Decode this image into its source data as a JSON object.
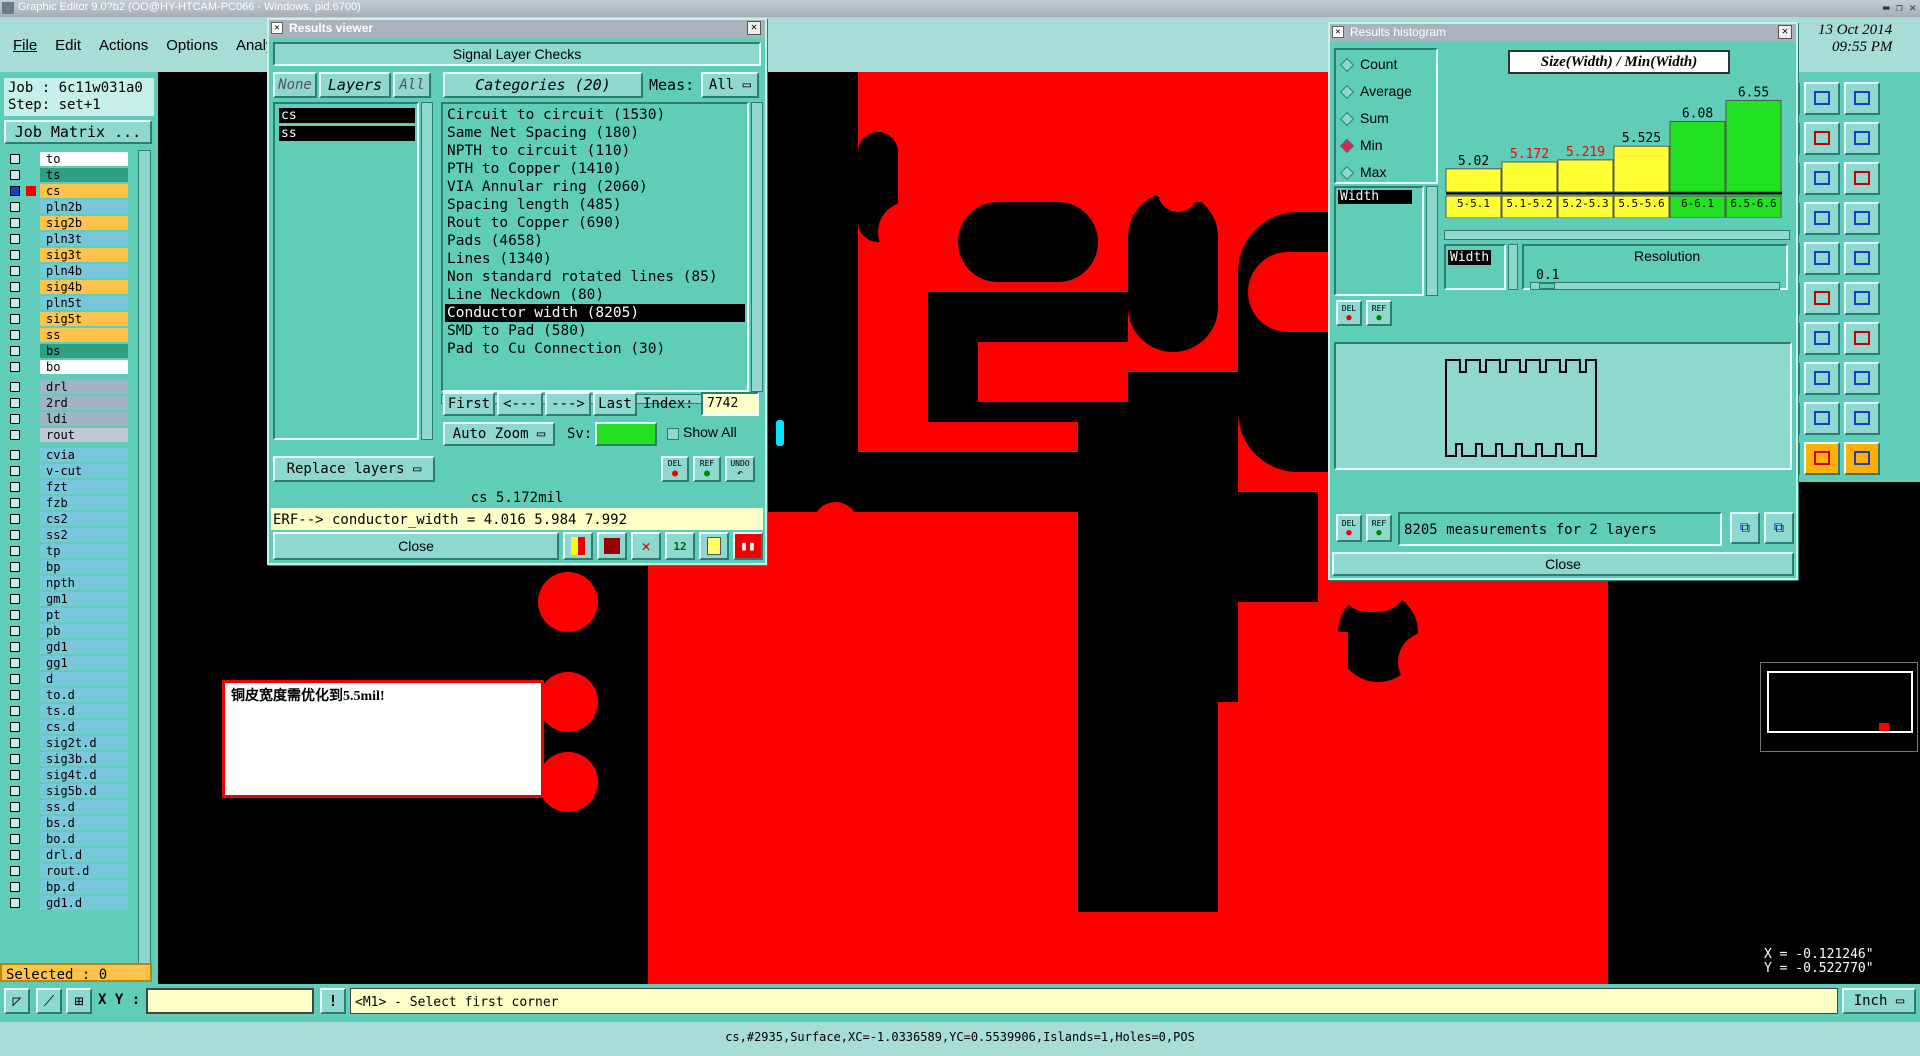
{
  "app": {
    "title": "Graphic Editor 9.0?b2 (OO@HY-HTCAM-PC066 - Windows, pid:6700)",
    "date": "13 Oct 2014",
    "time": "09:55 PM",
    "counter": "0"
  },
  "menu": [
    "File",
    "Edit",
    "Actions",
    "Options",
    "Analy"
  ],
  "job": {
    "job_label": "Job : 6c11w031a0",
    "step_label": "Step: set+1",
    "matrix_button": "Job Matrix ..."
  },
  "layers": [
    {
      "name": "to",
      "color": "#ffffff"
    },
    {
      "name": "ts",
      "color": "#2e9f83"
    },
    {
      "name": "cs",
      "color": "#ffc24a",
      "selected": true
    },
    {
      "name": "pln2b",
      "color": "#79c7dc"
    },
    {
      "name": "sig2b",
      "color": "#ffc24a"
    },
    {
      "name": "pln3t",
      "color": "#79c7dc"
    },
    {
      "name": "sig3t",
      "color": "#ffc24a"
    },
    {
      "name": "pln4b",
      "color": "#79c7dc"
    },
    {
      "name": "sig4b",
      "color": "#ffc24a"
    },
    {
      "name": "pln5t",
      "color": "#79c7dc"
    },
    {
      "name": "sig5t",
      "color": "#ffc24a"
    },
    {
      "name": "ss",
      "color": "#ffc24a"
    },
    {
      "name": "bs",
      "color": "#2e9f83"
    },
    {
      "name": "bo",
      "color": "#ffffff"
    },
    {
      "name": "drl",
      "color": "#9fb4c4"
    },
    {
      "name": "2rd",
      "color": "#9fb4c4"
    },
    {
      "name": "ldi",
      "color": "#9fb4c4"
    },
    {
      "name": "rout",
      "color": "#c0c8d4"
    },
    {
      "name": "cvia",
      "color": "#79c7dc"
    },
    {
      "name": "v-cut",
      "color": "#79c7dc"
    },
    {
      "name": "fzt",
      "color": "#79c7dc"
    },
    {
      "name": "fzb",
      "color": "#79c7dc"
    },
    {
      "name": "cs2",
      "color": "#79c7dc"
    },
    {
      "name": "ss2",
      "color": "#79c7dc"
    },
    {
      "name": "tp",
      "color": "#79c7dc"
    },
    {
      "name": "bp",
      "color": "#79c7dc"
    },
    {
      "name": "npth",
      "color": "#79c7dc"
    },
    {
      "name": "gm1",
      "color": "#79c7dc"
    },
    {
      "name": "pt",
      "color": "#79c7dc"
    },
    {
      "name": "pb",
      "color": "#79c7dc"
    },
    {
      "name": "gd1",
      "color": "#79c7dc"
    },
    {
      "name": "gg1",
      "color": "#79c7dc"
    },
    {
      "name": "d",
      "color": "#79c7dc"
    },
    {
      "name": "to.d",
      "color": "#79c7dc"
    },
    {
      "name": "ts.d",
      "color": "#79c7dc"
    },
    {
      "name": "cs.d",
      "color": "#79c7dc"
    },
    {
      "name": "sig2t.d",
      "color": "#79c7dc"
    },
    {
      "name": "sig3b.d",
      "color": "#79c7dc"
    },
    {
      "name": "sig4t.d",
      "color": "#79c7dc"
    },
    {
      "name": "sig5b.d",
      "color": "#79c7dc"
    },
    {
      "name": "ss.d",
      "color": "#79c7dc"
    },
    {
      "name": "bs.d",
      "color": "#79c7dc"
    },
    {
      "name": "bo.d",
      "color": "#79c7dc"
    },
    {
      "name": "drl.d",
      "color": "#79c7dc"
    },
    {
      "name": "rout.d",
      "color": "#79c7dc"
    },
    {
      "name": "bp.d",
      "color": "#79c7dc"
    },
    {
      "name": "gd1.d",
      "color": "#79c7dc"
    }
  ],
  "selected": "Selected : 0",
  "results_viewer": {
    "title": "Results viewer",
    "header": "Signal Layer Checks",
    "none": "None",
    "layers": "Layers",
    "all": "All",
    "categories_label": "Categories (20)",
    "meas_label": "Meas:",
    "meas_value": "All",
    "layer_list": [
      "cs",
      "ss"
    ],
    "categories": [
      "Circuit to circuit (1530)",
      "Same Net Spacing (180)",
      "NPTH to circuit (110)",
      "PTH to Copper (1410)",
      "VIA Annular ring (2060)",
      "Spacing length (485)",
      "Rout to Copper (690)",
      "Pads (4658)",
      "Lines (1340)",
      "Non standard rotated lines (85)",
      "Line Neckdown (80)",
      "Conductor width (8205)",
      "SMD to Pad (580)",
      "Pad to Cu Connection (30)"
    ],
    "selected_index": 11,
    "first": "First",
    "prev": "<---",
    "next": "--->",
    "last": "Last",
    "index_label": "Index:",
    "index_value": "7742",
    "auto_zoom": "Auto Zoom",
    "sv_label": "Sv:",
    "show_all": "Show All",
    "replace_layers": "Replace layers",
    "del": "DEL",
    "ref": "REF",
    "undo": "UNDO",
    "status": "cs 5.172mil",
    "erf": "ERF--> conductor_width = 4.016 5.984 7.992",
    "close": "Close"
  },
  "histogram": {
    "title": "Results histogram",
    "mode_options": [
      "Count",
      "Average",
      "Sum",
      "Min",
      "Max"
    ],
    "mode_selected": "Min",
    "metric": "Width",
    "header": "Size(Width) / Min(Width)",
    "resolution_label": "Resolution",
    "resolution_value": "0.1",
    "del": "DEL",
    "ref": "REF",
    "measurements": "8205 measurements for 2 layers",
    "close": "Close"
  },
  "chart_data": {
    "type": "bar",
    "title": "Size(Width) / Min(Width)",
    "categories": [
      "5-5.1",
      "5.1-5.2",
      "5.2-5.3",
      "5.5-5.6",
      "6-6.1",
      "6.5-6.6"
    ],
    "values": [
      5.02,
      5.172,
      5.219,
      5.525,
      6.08,
      6.55
    ],
    "value_labels": [
      "5.02",
      "5.172",
      "5.219",
      "5.525",
      "6.08",
      "6.55"
    ],
    "bar_colors": [
      "#ffff33",
      "#ffff33",
      "#ffff33",
      "#ffff33",
      "#22e022",
      "#22e022"
    ],
    "label_colors": [
      "#000000",
      "#ff0000",
      "#ff0000",
      "#000000",
      "#000000",
      "#000000"
    ],
    "ylim": [
      4.5,
      6.65
    ]
  },
  "note": "铜皮宽度需优化到5.5mil!",
  "coords": {
    "x": "X = -0.121246\"",
    "y": "Y = -0.522770\""
  },
  "bottom": {
    "xy_label": "X Y :",
    "prompt": "<M1> - Select first corner",
    "units": "Inch",
    "status": "cs,#2935,Surface,XC=-1.0336589,YC=0.5539906,Islands=1,Holes=0,POS"
  },
  "colors": {
    "copper": "#fe0000",
    "panel": "#5fcdb8",
    "highlight": "#00e5ff"
  }
}
